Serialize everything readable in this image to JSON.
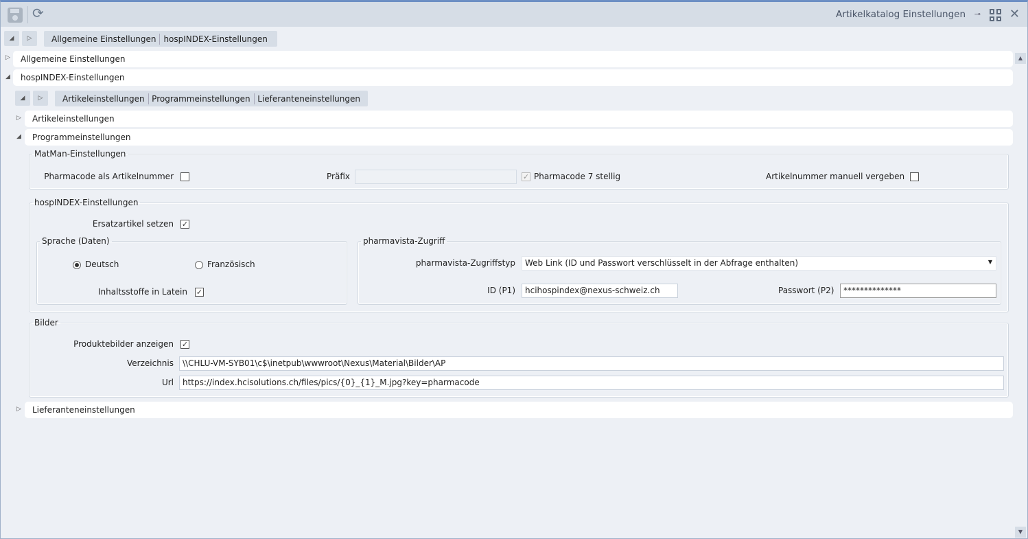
{
  "window": {
    "title": "Artikelkatalog Einstellungen"
  },
  "nav1": {
    "crumbs": [
      "Allgemeine Einstellungen",
      "hospINDEX-Einstellungen"
    ]
  },
  "sections": {
    "allgemein": "Allgemeine Einstellungen",
    "hospindex": "hospINDEX-Einstellungen"
  },
  "nav2": {
    "crumbs": [
      "Artikeleinstellungen",
      "Programmeinstellungen",
      "Lieferanteneinstellungen"
    ]
  },
  "subsections": {
    "artikel": "Artikeleinstellungen",
    "programm": "Programmeinstellungen",
    "lieferanten": "Lieferanteneinstellungen"
  },
  "matman": {
    "legend": "MatMan-Einstellungen",
    "pharmacode_label": "Pharmacode als Artikelnummer",
    "pharmacode_checked": false,
    "praefix_label": "Präfix",
    "praefix_value": "",
    "p7_label": "Pharmacode 7 stellig",
    "p7_checked": true,
    "manuell_label": "Artikelnummer manuell vergeben",
    "manuell_checked": false
  },
  "hospindex": {
    "legend": "hospINDEX-Einstellungen",
    "ersatz_label": "Ersatzartikel setzen",
    "ersatz_checked": true,
    "sprache": {
      "legend": "Sprache (Daten)",
      "deutsch": "Deutsch",
      "franz": "Französisch",
      "selected": "Deutsch",
      "latein_label": "Inhaltsstoffe in Latein",
      "latein_checked": true
    },
    "pharmavista": {
      "legend": "pharmavista-Zugriff",
      "typ_label": "pharmavista-Zugriffstyp",
      "typ_value": "Web Link (ID und Passwort verschlüsselt in der Abfrage enthalten)",
      "id_label": "ID (P1)",
      "id_value": "hcihospindex@nexus-schweiz.ch",
      "pw_label": "Passwort (P2)",
      "pw_value": "**************"
    }
  },
  "bilder": {
    "legend": "Bilder",
    "anzeigen_label": "Produktebilder anzeigen",
    "anzeigen_checked": true,
    "verz_label": "Verzeichnis",
    "verz_value": "\\\\CHLU-VM-SYB01\\c$\\inetpub\\wwwroot\\Nexus\\Material\\Bilder\\AP",
    "url_label": "Url",
    "url_value": "https://index.hcisolutions.ch/files/pics/{0}_{1}_M.jpg?key=pharmacode"
  }
}
